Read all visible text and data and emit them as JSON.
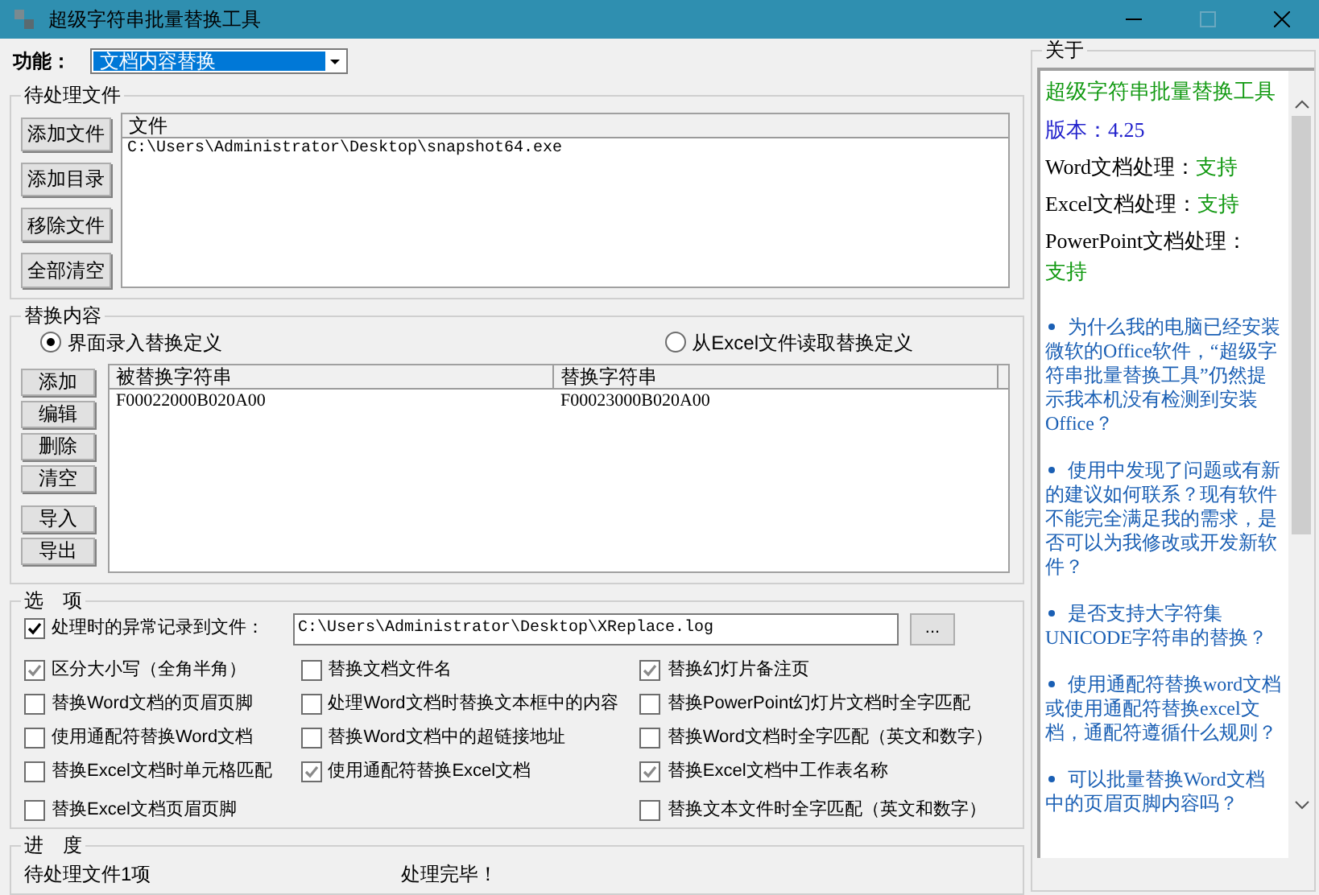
{
  "window": {
    "title": "超级字符串批量替换工具"
  },
  "function": {
    "label": "功能：",
    "value": "文档内容替换"
  },
  "files_group": {
    "title": "待处理文件",
    "buttons": [
      "添加文件",
      "添加目录",
      "移除文件",
      "全部清空"
    ],
    "column": "文件",
    "rows": [
      "C:\\Users\\Administrator\\Desktop\\snapshot64.exe"
    ]
  },
  "replace_group": {
    "title": "替换内容",
    "sources": [
      {
        "label": "界面录入替换定义",
        "selected": true
      },
      {
        "label": "从Excel文件读取替换定义",
        "selected": false
      }
    ],
    "buttons": [
      "添加",
      "编辑",
      "删除",
      "清空",
      "导入",
      "导出"
    ],
    "columns": [
      "被替换字符串",
      "替换字符串"
    ],
    "rows": [
      [
        "F00022000B020A00",
        "F00023000B020A00"
      ]
    ]
  },
  "options_group": {
    "title": "选　项",
    "log": {
      "label": "处理时的异常记录到文件：",
      "checked": true,
      "value": "C:\\Users\\Administrator\\Desktop\\XReplace.log",
      "browse": "..."
    },
    "columns": [
      [
        {
          "label": "区分大小写（全角半角）",
          "checked": true
        },
        {
          "label": "替换Word文档的页眉页脚",
          "checked": false
        },
        {
          "label": "使用通配符替换Word文档",
          "checked": false
        },
        {
          "label": "替换Excel文档时单元格匹配",
          "checked": false
        },
        {
          "label": "替换Excel文档页眉页脚",
          "checked": false
        }
      ],
      [
        {
          "label": "替换文档文件名",
          "checked": false
        },
        {
          "label": "处理Word文档时替换文本框中的内容",
          "checked": false
        },
        {
          "label": "替换Word文档中的超链接地址",
          "checked": false
        },
        {
          "label": "使用通配符替换Excel文档",
          "checked": true
        }
      ],
      [
        {
          "label": "替换幻灯片备注页",
          "checked": true
        },
        {
          "label": "替换PowerPoint幻灯片文档时全字匹配",
          "checked": false
        },
        {
          "label": "替换Word文档时全字匹配（英文和数字）",
          "checked": false
        },
        {
          "label": "替换Excel文档中工作表名称",
          "checked": true
        },
        {
          "label": "替换文本文件时全字匹配（英文和数字）",
          "checked": false
        }
      ]
    ]
  },
  "progress_group": {
    "title": "进　度",
    "pending": "待处理文件1项",
    "status": "处理完毕！"
  },
  "about": {
    "title": "关于",
    "app_name": "超级字符串批量替换工具",
    "version": "版本：4.25",
    "support": [
      {
        "label": "Word文档处理：",
        "value": "支持"
      },
      {
        "label": "Excel文档处理：",
        "value": "支持"
      },
      {
        "label": "PowerPoint文档处理：",
        "value": "支持"
      }
    ],
    "faq": [
      "为什么我的电脑已经安装微软的Office软件，“超级字符串批量替换工具”仍然提示我本机没有检测到安装Office？",
      "使用中发现了问题或有新的建议如何联系？现有软件不能完全满足我的需求，是否可以为我修改或开发新软件？",
      "是否支持大字符集UNICODE字符串的替换？",
      "使用通配符替换word文档或使用通配符替换excel文档，通配符遵循什么规则？",
      "可以批量替换Word文档中的页眉页脚内容吗？"
    ]
  }
}
